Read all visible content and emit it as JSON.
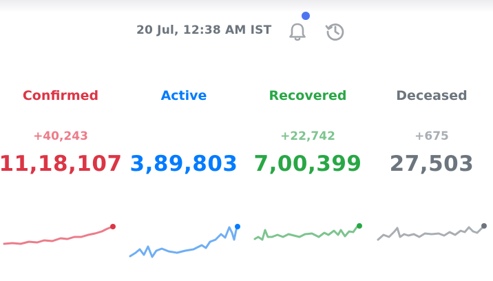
{
  "header": {
    "timestamp": "20 Jul, 12:38 AM IST",
    "bell_icon": "bell-icon",
    "notification_dot_color": "#4c75f2",
    "history_icon": "history-icon"
  },
  "stats": [
    {
      "label": "Confirmed",
      "delta": "+40,243",
      "total": "11,18,107",
      "color": "#dc3545",
      "light": "#ec7c89"
    },
    {
      "label": "Active",
      "delta": "",
      "total": "3,89,803",
      "color": "#007bff",
      "light": "#6eaef5"
    },
    {
      "label": "Recovered",
      "delta": "+22,742",
      "total": "7,00,399",
      "color": "#28a745",
      "light": "#7dc48f"
    },
    {
      "label": "Deceased",
      "delta": "+675",
      "total": "27,503",
      "color": "#6c757d",
      "light": "#a9aeb3"
    }
  ]
}
